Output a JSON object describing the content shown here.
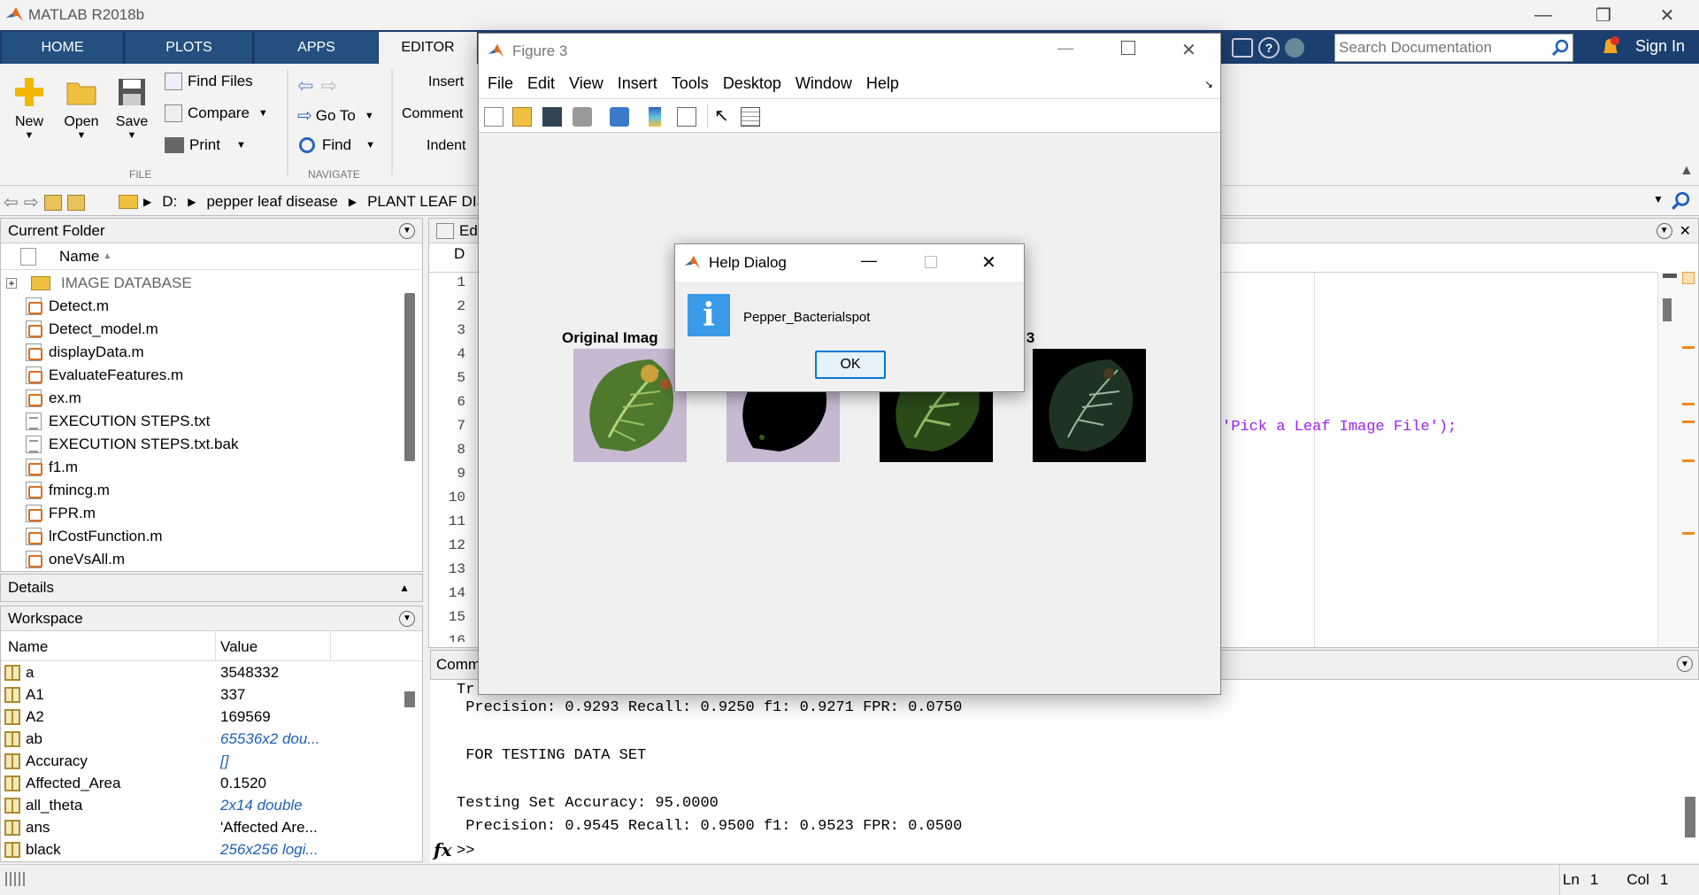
{
  "window": {
    "title": "MATLAB R2018b"
  },
  "tabs": [
    {
      "label": "HOME"
    },
    {
      "label": "PLOTS"
    },
    {
      "label": "APPS"
    },
    {
      "label": "EDITOR"
    }
  ],
  "search": {
    "placeholder": "Search Documentation",
    "sign_in": "Sign In"
  },
  "ribbon": {
    "new": "New",
    "open": "Open",
    "save": "Save",
    "find_files": "Find Files",
    "compare": "Compare",
    "print": "Print",
    "go_to": "Go To",
    "find": "Find",
    "insert": "Insert",
    "comment": "Comment",
    "indent": "Indent",
    "section_file": "FILE",
    "section_navigate": "NAVIGATE"
  },
  "address": {
    "path": [
      "D:",
      "pepper leaf disease",
      "PLANT LEAF DIS"
    ]
  },
  "current_folder": {
    "title": "Current Folder",
    "column": "Name",
    "items": [
      {
        "name": "IMAGE DATABASE",
        "kind": "folder"
      },
      {
        "name": "Detect.m",
        "kind": "m"
      },
      {
        "name": "Detect_model.m",
        "kind": "m"
      },
      {
        "name": "displayData.m",
        "kind": "m"
      },
      {
        "name": "EvaluateFeatures.m",
        "kind": "m"
      },
      {
        "name": "ex.m",
        "kind": "m"
      },
      {
        "name": "EXECUTION STEPS.txt",
        "kind": "txt"
      },
      {
        "name": "EXECUTION STEPS.txt.bak",
        "kind": "txt"
      },
      {
        "name": "f1.m",
        "kind": "m"
      },
      {
        "name": "fmincg.m",
        "kind": "m"
      },
      {
        "name": "FPR.m",
        "kind": "m"
      },
      {
        "name": "lrCostFunction.m",
        "kind": "m"
      },
      {
        "name": "oneVsAll.m",
        "kind": "m"
      }
    ]
  },
  "details": {
    "title": "Details"
  },
  "workspace": {
    "title": "Workspace",
    "col_name": "Name",
    "col_value": "Value",
    "rows": [
      {
        "name": "a",
        "value": "3548332",
        "italic": false
      },
      {
        "name": "A1",
        "value": "337",
        "italic": false
      },
      {
        "name": "A2",
        "value": "169569",
        "italic": false
      },
      {
        "name": "ab",
        "value": "65536x2 dou...",
        "italic": true
      },
      {
        "name": "Accuracy",
        "value": "[]",
        "italic": true
      },
      {
        "name": "Affected_Area",
        "value": "0.1520",
        "italic": false
      },
      {
        "name": "all_theta",
        "value": "2x14 double",
        "italic": true
      },
      {
        "name": "ans",
        "value": "'Affected Are...",
        "italic": false
      },
      {
        "name": "black",
        "value": "256x256 logi...",
        "italic": true
      }
    ]
  },
  "editor": {
    "tab_label": "Ed",
    "file_tab": "D",
    "line_numbers": [
      "1",
      "2",
      "3",
      "4",
      "5",
      "6",
      "7",
      "8",
      "9",
      "10",
      "11",
      "12",
      "13",
      "14",
      "15",
      "16"
    ],
    "code_fragment": "'Pick a Leaf Image File');"
  },
  "figure": {
    "title": "Figure 3",
    "menu": [
      "File",
      "Edit",
      "View",
      "Insert",
      "Tools",
      "Desktop",
      "Window",
      "Help"
    ],
    "panels": [
      {
        "title": "Original Imag"
      },
      {
        "title": ""
      },
      {
        "title": ""
      },
      {
        "title": "Cluster 3"
      }
    ]
  },
  "dialog": {
    "title": "Help Dialog",
    "message": "Pepper_Bacterialspot",
    "ok": "OK"
  },
  "command_window": {
    "title": "Comm",
    "lines": [
      "Tr",
      " Precision: 0.9293 Recall: 0.9250 f1: 0.9271 FPR: 0.0750",
      "",
      " FOR TESTING DATA SET",
      "",
      "Testing Set Accuracy: 95.0000",
      " Precision: 0.9545 Recall: 0.9500 f1: 0.9523 FPR: 0.0500"
    ],
    "prompt": ">>",
    "fx": "fx"
  },
  "status": {
    "ln_label": "Ln",
    "ln": "1",
    "col_label": "Col",
    "col": "1"
  }
}
